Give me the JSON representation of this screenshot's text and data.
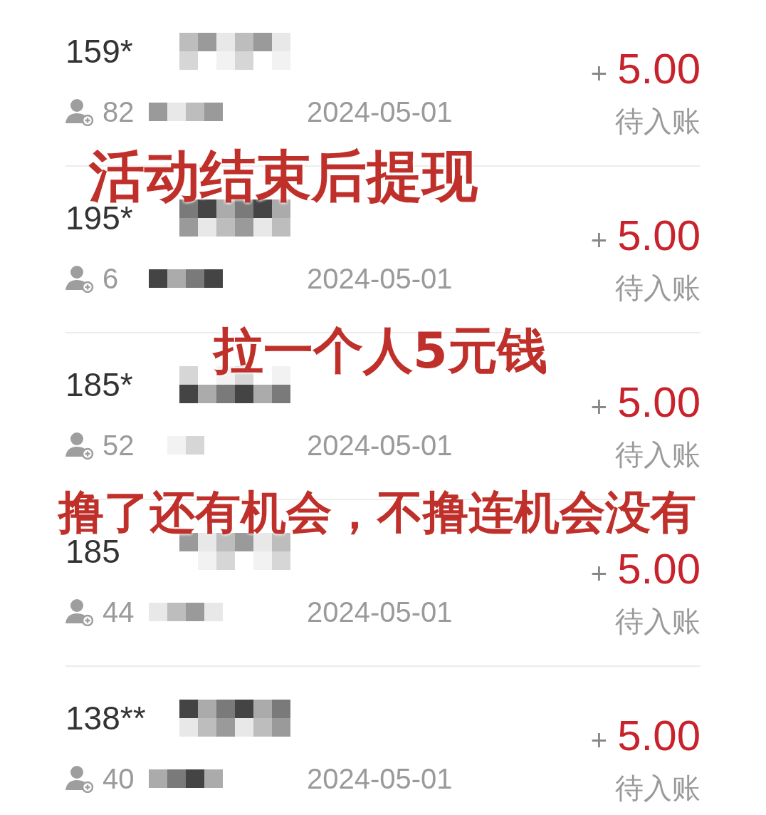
{
  "records": [
    {
      "phone": "159*",
      "plus": "+",
      "amount": "5.00",
      "inviter": "82",
      "date": "2024-05-01",
      "status": "待入账"
    },
    {
      "phone": "195*",
      "plus": "+",
      "amount": "5.00",
      "inviter": "6",
      "date": "2024-05-01",
      "status": "待入账"
    },
    {
      "phone": "185*",
      "plus": "+",
      "amount": "5.00",
      "inviter": "52",
      "date": "2024-05-01",
      "status": "待入账"
    },
    {
      "phone": "185",
      "plus": "+",
      "amount": "5.00",
      "inviter": "44",
      "date": "2024-05-01",
      "status": "待入账"
    },
    {
      "phone": "138**",
      "plus": "+",
      "amount": "5.00",
      "inviter": "40",
      "date": "2024-05-01",
      "status": "待入账"
    }
  ],
  "annotations": [
    {
      "text": "活动结束后提现",
      "kind": "large"
    },
    {
      "text": "拉一个人5元钱",
      "kind": "medium"
    },
    {
      "text": "撸了还有机会，不撸连机会没有",
      "kind": "wide"
    }
  ]
}
